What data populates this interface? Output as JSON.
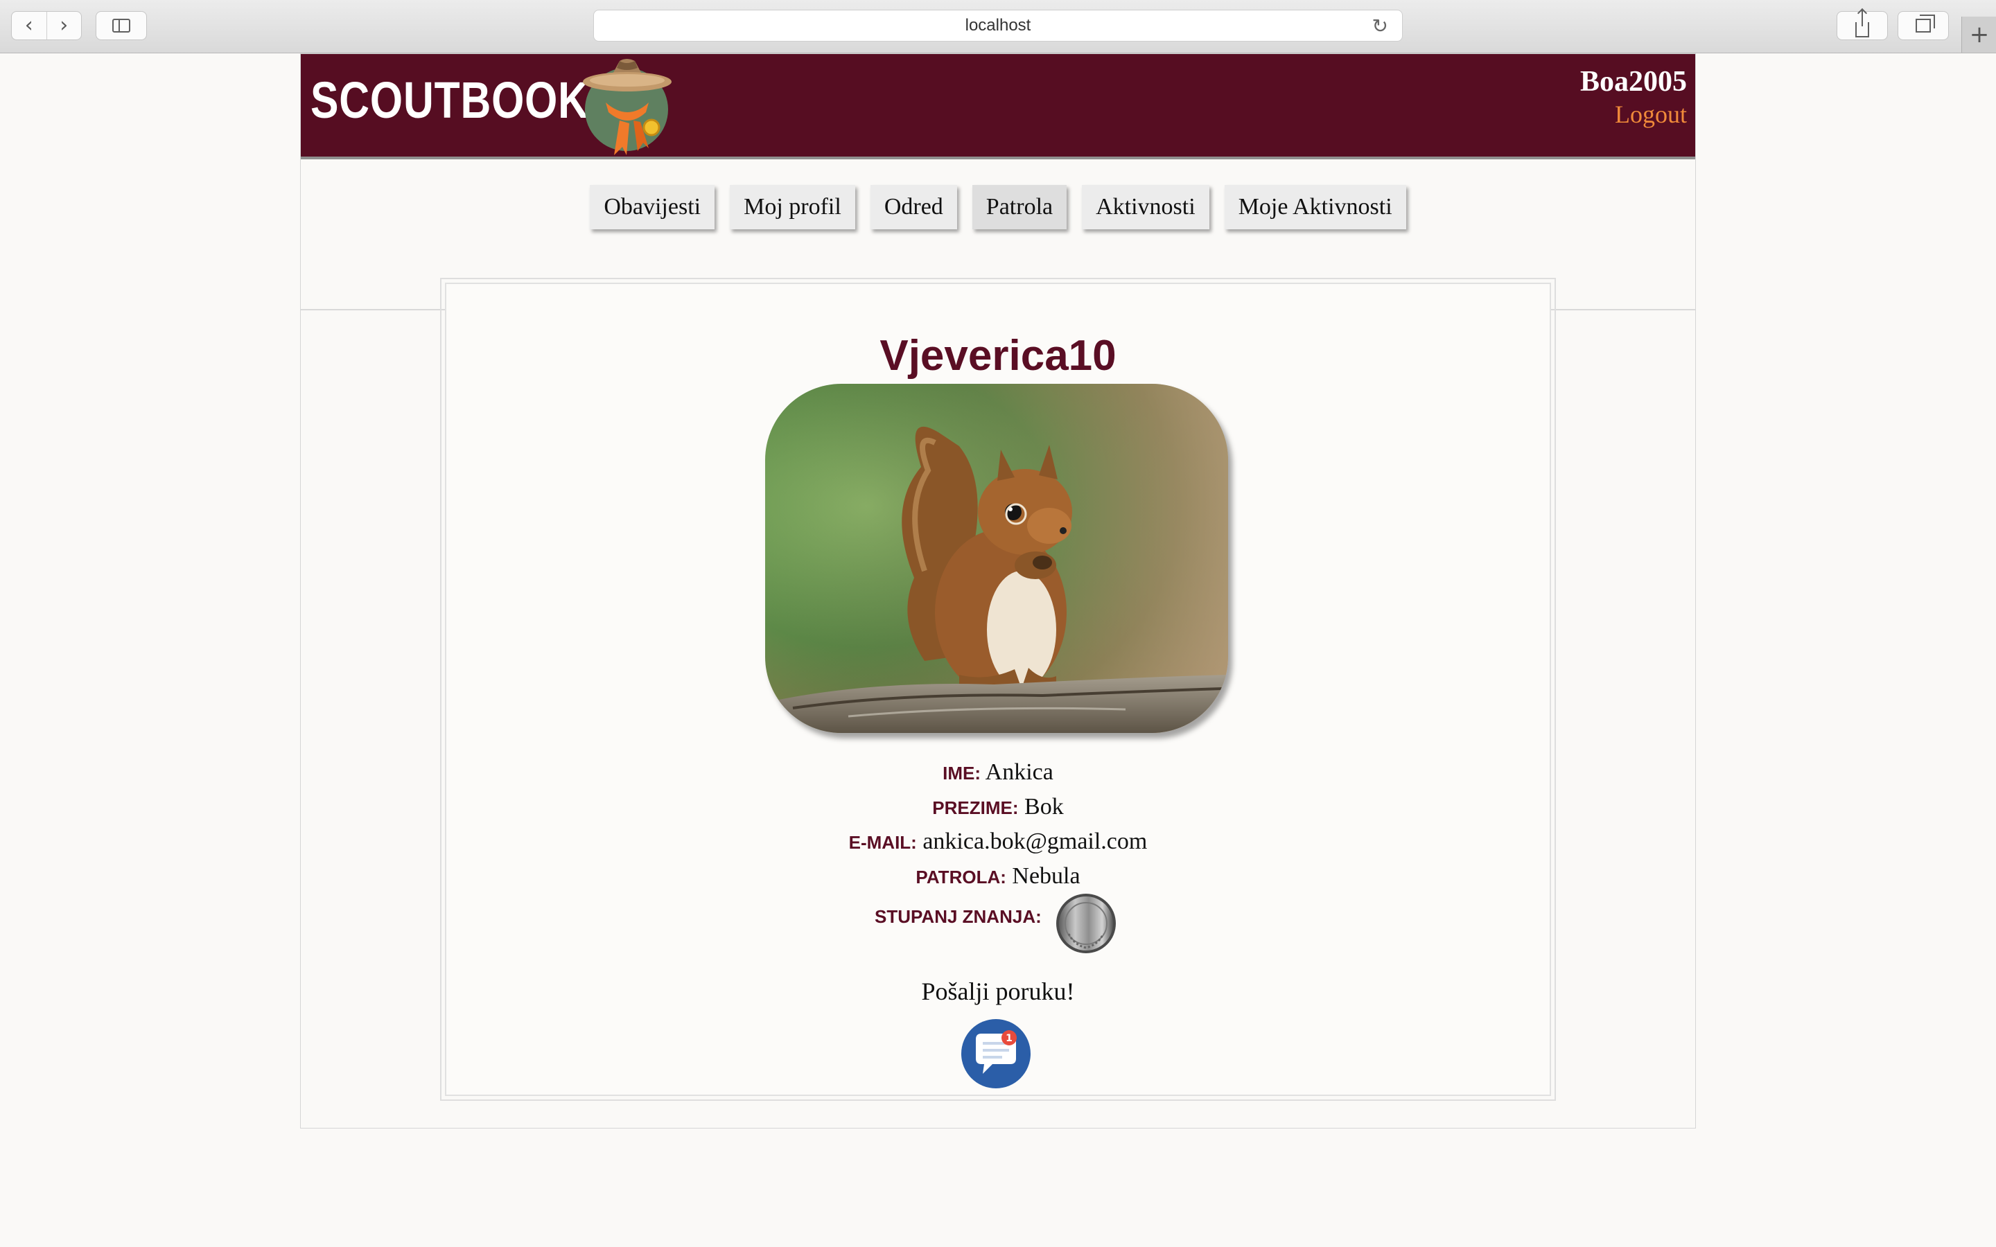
{
  "browser": {
    "url": "localhost",
    "back_label": "‹",
    "forward_label": "›",
    "reload_label": "↻",
    "new_tab_label": "+"
  },
  "header": {
    "brand": "SCOUTBOOK",
    "username": "Boa2005",
    "logout_label": "Logout"
  },
  "nav": {
    "items": [
      {
        "label": "Obavijesti"
      },
      {
        "label": "Moj profil"
      },
      {
        "label": "Odred"
      },
      {
        "label": "Patrola",
        "active": true
      },
      {
        "label": "Aktivnosti"
      },
      {
        "label": "Moje Aktivnosti"
      }
    ]
  },
  "profile": {
    "username": "Vjeverica10",
    "photo_icon": "squirrel-photo",
    "fields": [
      {
        "label": "IME:",
        "value": "Ankica"
      },
      {
        "label": "PREZIME:",
        "value": "Bok"
      },
      {
        "label": "E-MAIL:",
        "value": "ankica.bok@gmail.com"
      },
      {
        "label": "PATROLA:",
        "value": "Nebula"
      }
    ],
    "rank_label": "STUPANJ ZNANJA:",
    "rank_icon": "silver-medal-icon",
    "message_label": "Pošalji poruku!",
    "message_icon": "chat-bubble-icon",
    "message_badge": "1"
  },
  "colors": {
    "brand": "#560d22",
    "accent": "#f08a3a",
    "title": "#5a0e24",
    "page_bg": "#faf9f7"
  }
}
